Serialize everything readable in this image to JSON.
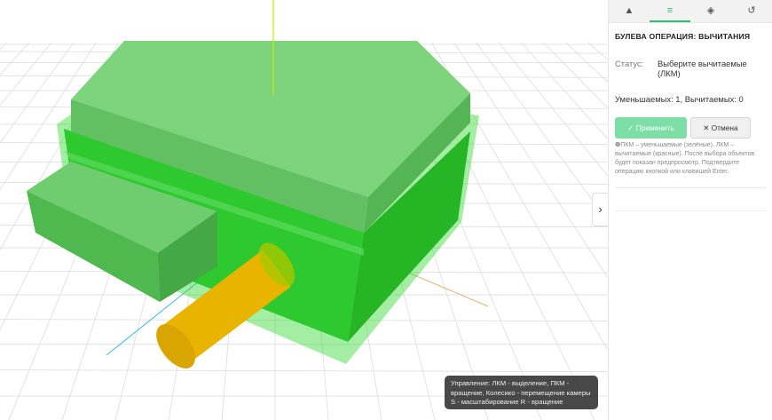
{
  "viewport": {
    "colors": {
      "body": "#2ec92e",
      "top": "#5cc861",
      "cylinder": "#e8b400",
      "axis_y": "#c8e800",
      "axis_x": "#e8b070",
      "axis_z": "#30b8e8"
    },
    "tooltip": "Управление: ЛКМ - выделение, ПКМ - вращение, Колесико - перемещение камеры S - масштабирование R - вращение",
    "collapse_icon": "›"
  },
  "panel": {
    "tabs": [
      {
        "icon": "shapes-icon",
        "glyph": "▲"
      },
      {
        "icon": "sliders-icon",
        "glyph": "≡"
      },
      {
        "icon": "layers-icon",
        "glyph": "◈"
      },
      {
        "icon": "history-icon",
        "glyph": "↺"
      }
    ],
    "title": "БУЛЕВА ОПЕРАЦИЯ: ВЫЧИТАНИЯ",
    "status_label": "Статус:",
    "status_value": "Выберите вычитаемые (ЛКМ)",
    "counts": "Уменьшаемых: 1, Вычитаемых: 0",
    "apply": "Применить",
    "apply_icon": "✓",
    "cancel": "Отмена",
    "cancel_icon": "✕",
    "hint_icon": "❶",
    "hint": "ПКМ – уменьшаемые (зелёные), ЛКМ – вычитаемые (красные). После выбора объектов будет показан предпросмотр. Подтвердите операцию кнопкой или клавишей Enter."
  }
}
